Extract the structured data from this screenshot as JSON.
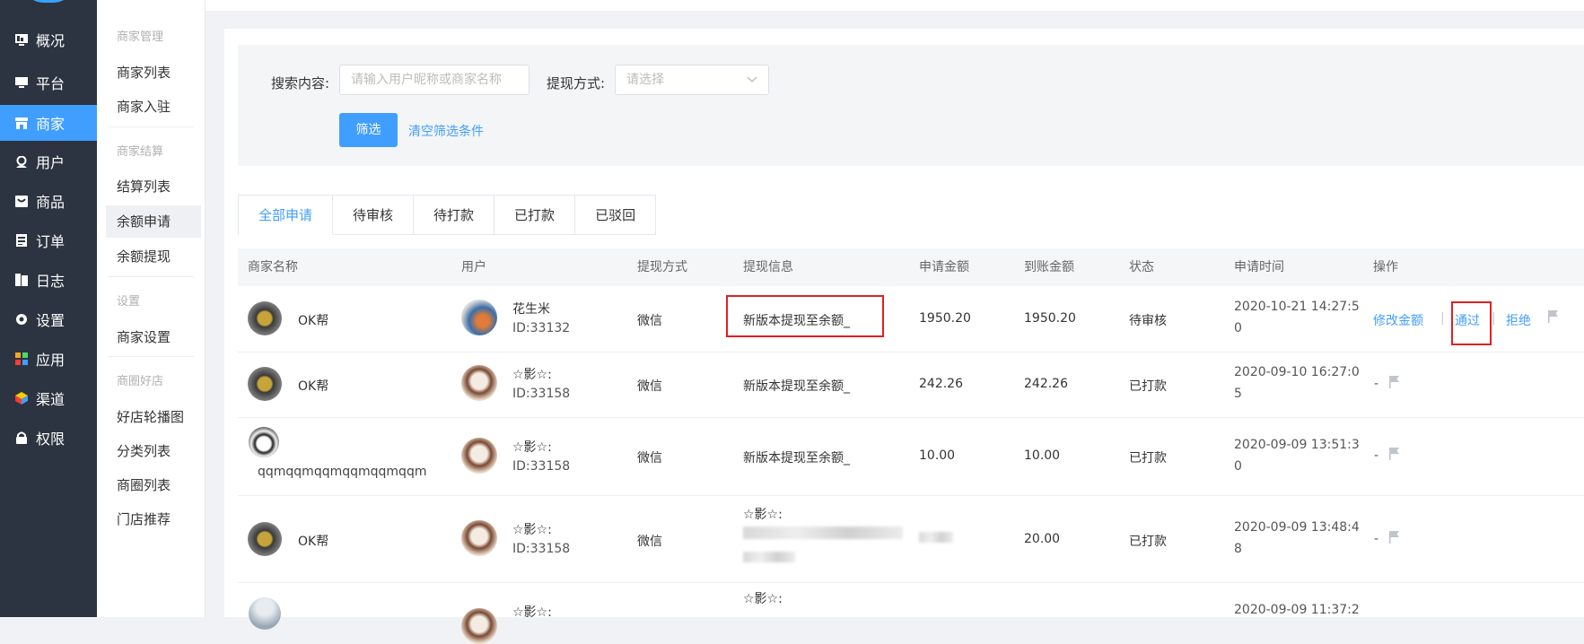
{
  "sidebar": {
    "items": [
      {
        "label": "概况",
        "icon": "dashboard-icon"
      },
      {
        "label": "平台",
        "icon": "monitor-icon"
      },
      {
        "label": "商家",
        "icon": "shop-icon"
      },
      {
        "label": "用户",
        "icon": "user-icon"
      },
      {
        "label": "商品",
        "icon": "goods-icon"
      },
      {
        "label": "订单",
        "icon": "order-icon"
      },
      {
        "label": "日志",
        "icon": "log-icon"
      },
      {
        "label": "设置",
        "icon": "gear-icon"
      },
      {
        "label": "应用",
        "icon": "apps-icon"
      },
      {
        "label": "渠道",
        "icon": "cube-icon"
      },
      {
        "label": "权限",
        "icon": "lock-icon"
      }
    ]
  },
  "subnav": {
    "groups": [
      {
        "title": "商家管理",
        "items": [
          "商家列表",
          "商家入驻"
        ]
      },
      {
        "title": "商家结算",
        "items": [
          "结算列表",
          "余额申请",
          "余额提现"
        ]
      },
      {
        "title": "设置",
        "items": [
          "商家设置"
        ]
      },
      {
        "title": "商圈好店",
        "items": [
          "好店轮播图",
          "分类列表",
          "商圈列表",
          "门店推荐"
        ]
      }
    ]
  },
  "filter": {
    "search_label": "搜索内容:",
    "search_placeholder": "请输入用户昵称或商家名称",
    "method_label": "提现方式:",
    "method_placeholder": "请选择",
    "filter_button": "筛选",
    "clear_link": "清空筛选条件"
  },
  "tabs": [
    "全部申请",
    "待审核",
    "待打款",
    "已打款",
    "已驳回"
  ],
  "table": {
    "columns": [
      "商家名称",
      "用户",
      "提现方式",
      "提现信息",
      "申请金额",
      "到账金额",
      "状态",
      "申请时间",
      "操作"
    ],
    "rows": [
      {
        "merchant": "OK帮",
        "user_name": "花生米",
        "user_id": "ID:33132",
        "method": "微信",
        "info": "新版本提现至余额_",
        "apply_amount": "1950.20",
        "received_amount": "1950.20",
        "status": "待审核",
        "time_line1": "2020-10-21 14:27:5",
        "time_line2": "0",
        "actions": {
          "modify": "修改金额",
          "sep1": "|",
          "approve": "通过",
          "sep2": "|",
          "reject": "拒绝"
        }
      },
      {
        "merchant": "OK帮",
        "user_name": "☆影☆:",
        "user_id": "ID:33158",
        "method": "微信",
        "info": "新版本提现至余额_",
        "apply_amount": "242.26",
        "received_amount": "242.26",
        "status": "已打款",
        "time_line1": "2020-09-10 16:27:0",
        "time_line2": "5",
        "actions": {
          "dash": "-"
        }
      },
      {
        "merchant": "qqmqqmqqmqqmqqmqqm",
        "user_name": "☆影☆:",
        "user_id": "ID:33158",
        "method": "微信",
        "info": "新版本提现至余额_",
        "apply_amount": "10.00",
        "received_amount": "10.00",
        "status": "已打款",
        "time_line1": "2020-09-09 13:51:3",
        "time_line2": "0",
        "actions": {
          "dash": "-"
        }
      },
      {
        "merchant": "OK帮",
        "user_name": "☆影☆:",
        "user_id": "ID:33158",
        "method": "微信",
        "info": "☆影☆:",
        "apply_amount": "",
        "received_amount": "20.00",
        "status": "已打款",
        "time_line1": "2020-09-09 13:48:4",
        "time_line2": "8",
        "actions": {
          "dash": "-"
        }
      },
      {
        "merchant": "",
        "user_name": "☆影☆:",
        "user_id": "",
        "method": "",
        "info": "☆影☆:",
        "apply_amount": "",
        "received_amount": "",
        "status": "",
        "time_line1": "2020-09-09 11:37:2",
        "time_line2": "",
        "actions": {}
      }
    ]
  },
  "colors": {
    "accent": "#409eff",
    "sidebar": "#2b3440",
    "highlight_box": "#e02020"
  }
}
